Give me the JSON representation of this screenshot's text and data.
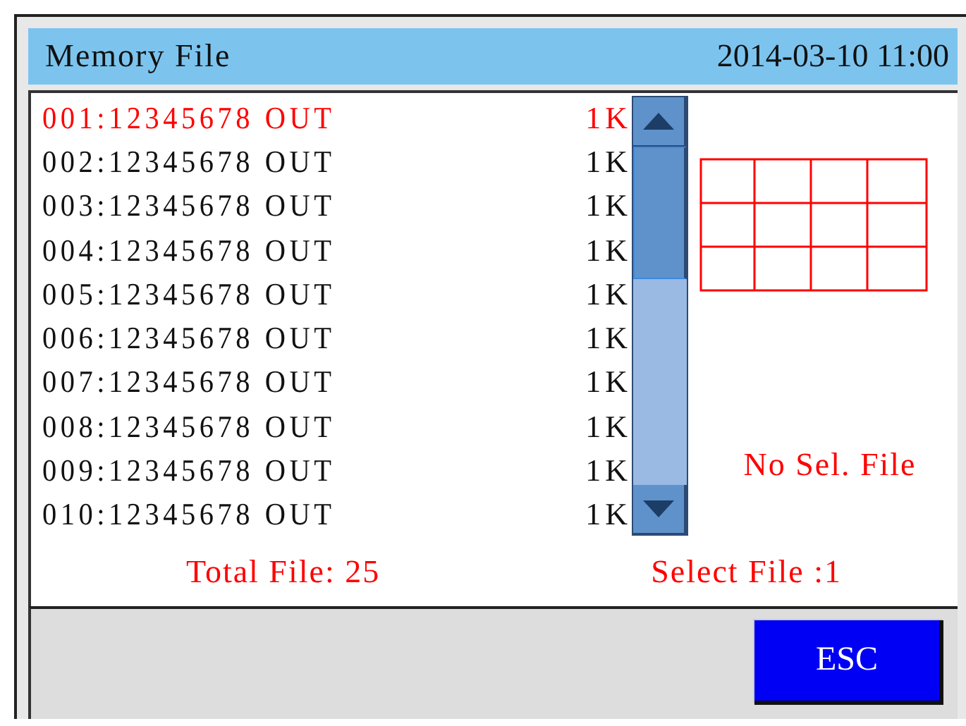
{
  "header": {
    "title": "Memory File",
    "datetime": "2014-03-10 11:00"
  },
  "files": [
    {
      "name": "001:12345678 OUT",
      "size": "1K",
      "selected": true
    },
    {
      "name": "002:12345678 OUT",
      "size": "1K",
      "selected": false
    },
    {
      "name": "003:12345678 OUT",
      "size": "1K",
      "selected": false
    },
    {
      "name": "004:12345678 OUT",
      "size": "1K",
      "selected": false
    },
    {
      "name": "005:12345678 OUT",
      "size": "1K",
      "selected": false
    },
    {
      "name": "006:12345678 OUT",
      "size": "1K",
      "selected": false
    },
    {
      "name": "007:12345678 OUT",
      "size": "1K",
      "selected": false
    },
    {
      "name": "008:12345678 OUT",
      "size": "1K",
      "selected": false
    },
    {
      "name": "009:12345678 OUT",
      "size": "1K",
      "selected": false
    },
    {
      "name": "010:12345678 OUT",
      "size": "1K",
      "selected": false
    }
  ],
  "preview": {
    "message": "No Sel. File"
  },
  "total_files": "Total File: 25",
  "selected_files": "Select File :1",
  "buttons": [
    "ESC"
  ]
}
